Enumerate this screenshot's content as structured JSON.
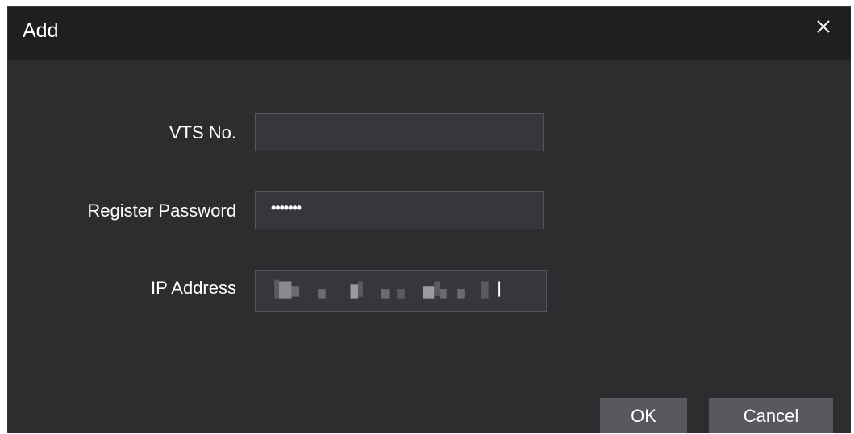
{
  "dialog": {
    "title": "Add",
    "close_icon": "close-icon"
  },
  "form": {
    "vts_no": {
      "label": "VTS No.",
      "value": ""
    },
    "register_password": {
      "label": "Register Password",
      "masked_value": "•••••••"
    },
    "ip_address": {
      "label": "IP Address",
      "value": ""
    }
  },
  "buttons": {
    "ok": "OK",
    "cancel": "Cancel"
  },
  "colors": {
    "dialog_bg": "#2d2d30",
    "titlebar_bg": "#1f1f21",
    "input_bg": "#36373c",
    "button_bg": "#58595e",
    "text": "#ffffff"
  }
}
